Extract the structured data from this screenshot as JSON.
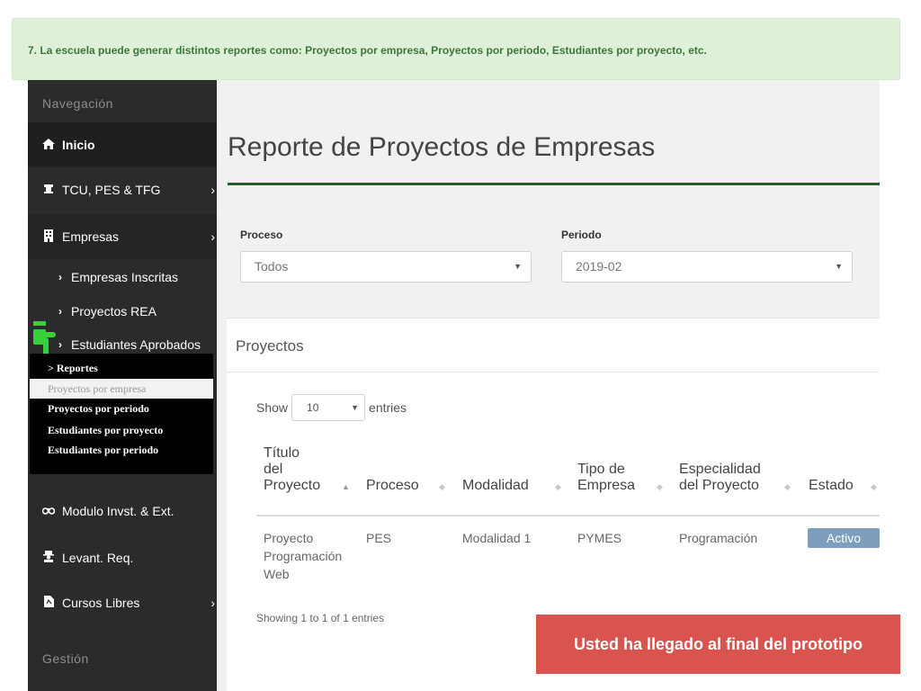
{
  "notice": {
    "text": "7. La escuela puede generar distintos reportes como: Proyectos por empresa, Proyectos por periodo, Estudiantes por proyecto, etc."
  },
  "sidebar": {
    "nav_header": "Navegación",
    "items": [
      {
        "label": "Inicio",
        "icon": "home-icon"
      },
      {
        "label": "TCU, PES & TFG",
        "icon": "graduation-cap-icon",
        "chevron": "›"
      },
      {
        "label": "Empresas",
        "icon": "building-icon",
        "chevron": "›"
      }
    ],
    "sub_items": [
      {
        "label": "Empresas Inscritas",
        "arrow": "›"
      },
      {
        "label": "Proyectos REA",
        "arrow": "›"
      },
      {
        "label": "Estudiantes Aprobados",
        "arrow": "›"
      }
    ],
    "more_items": [
      {
        "label": "Modulo Invst. & Ext.",
        "icon": "binoculars-icon"
      },
      {
        "label": "Levant. Req.",
        "icon": "user-secret-icon"
      },
      {
        "label": "Cursos Libres",
        "icon": "file-pdf-icon",
        "chevron": "›"
      }
    ],
    "manage_header": "Gestión"
  },
  "popup": {
    "items": [
      "> Reportes",
      "Proyectos por empresa",
      "Proyectos por periodo",
      "Estudiantes por proyecto",
      "Estudiantes por periodo"
    ]
  },
  "main": {
    "title": "Reporte de Proyectos de Empresas",
    "filters": {
      "proceso_label": "Proceso",
      "proceso_value": "Todos",
      "periodo_label": "Periodo",
      "periodo_value": "2019-02",
      "caret": "▼"
    },
    "panel": {
      "title": "Proyectos",
      "show_label": "Show",
      "length_value": "10",
      "entries_label": "entries",
      "columns": [
        "Título\ndel\nProyecto",
        "Proceso",
        "Modalidad",
        "Tipo de\nEmpresa",
        "Especialidad\ndel Proyecto",
        "Estado"
      ],
      "rows": [
        {
          "titulo": "Proyecto\nProgramación\nWeb",
          "proceso": "PES",
          "modalidad": "Modalidad 1",
          "tipo": "PYMES",
          "especialidad": "Programación",
          "estado": "Activo"
        }
      ],
      "info": "Showing 1 to 1 of 1 entries"
    }
  },
  "end_button": "Usted ha llegado al final del prototipo",
  "colors": {
    "sidebar_bg": "#2b2b2b",
    "accent_green": "#0a6b2a",
    "notice_bg": "#dff0d8",
    "badge_bg": "#7d9fbd",
    "end_button_bg": "#d9534f",
    "hand_green": "#39d13b"
  }
}
